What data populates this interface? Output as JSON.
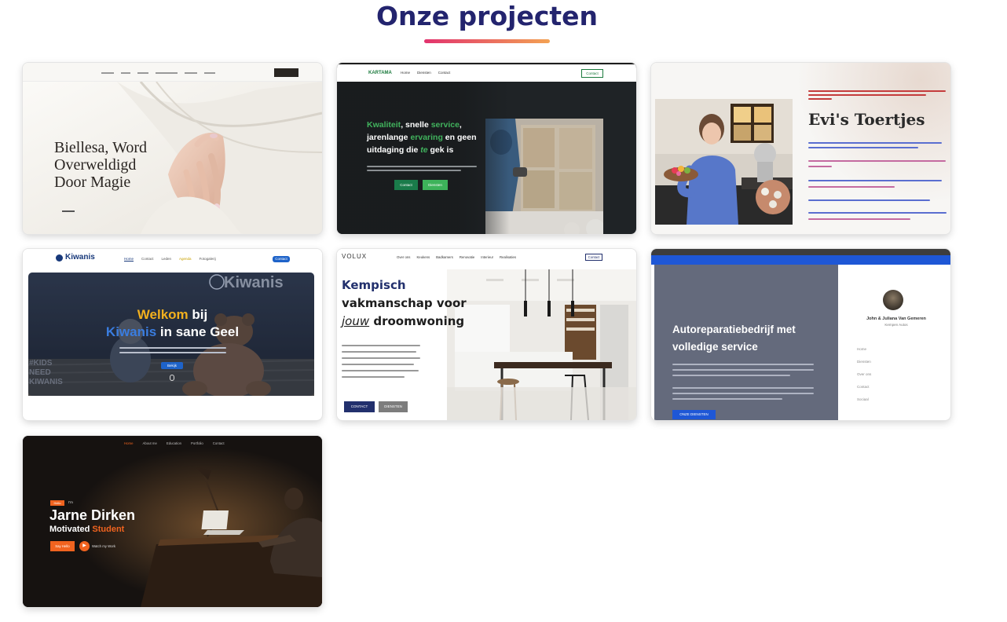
{
  "section": {
    "title": "Onze projecten"
  },
  "colors": {
    "title": "#23246e",
    "accent_start": "#e2336e",
    "accent_end": "#f3a253"
  },
  "projects": [
    {
      "headline": [
        "Biellesa, Word",
        "Overweldigd",
        "Door Magie"
      ],
      "image_subject": "hand with manicured nails in white fabric"
    },
    {
      "logo": "KARTAMA",
      "nav": [
        "Home",
        "Diensten",
        "Contact"
      ],
      "cta": "Contact",
      "headline_parts": {
        "green1": "Kwaliteit",
        "white1": ", snelle ",
        "green2": "service",
        "white2": ",",
        "line2a": "jarenlange ",
        "green3": "ervaring",
        "line2b": " en geen",
        "line3a": "uitdaging die ",
        "green4": "te",
        "line3b": " gek is"
      },
      "buttons": [
        "Contact",
        "Diensten"
      ],
      "image_subject": "worker installing insulation panels"
    },
    {
      "heading": "Evi's Toertjes",
      "image_subject": "woman in blue sweater holding a cake in a kitchen"
    },
    {
      "logo": "Kiwanis",
      "nav": [
        "Home",
        "Contact",
        "Leden",
        "Agenda",
        "Fotogalerij"
      ],
      "cta": "Contact",
      "hero_watermark": "Kiwanis",
      "headline_line1_yellow": "Welkom",
      "headline_line1_white": " bij",
      "headline_line2_blue": "Kiwanis",
      "headline_line2_white": " in sane Geel",
      "side_text": [
        "#KIDS",
        "NEED",
        "KIWANIS"
      ],
      "button": "Bekijk"
    },
    {
      "logo": "VOLUX",
      "nav": [
        "Over ons",
        "Keukens",
        "Badkamers",
        "Renovatie",
        "Interieur",
        "Realisaties"
      ],
      "cta": "Contact",
      "headline_blue": "Kempisch",
      "headline_line2": "vakmanschap voor",
      "headline_line3a": "jouw",
      "headline_line3b": " droomwoning",
      "buttons": [
        "CONTACT",
        "DIENSTEN"
      ],
      "image_subject": "modern white kitchen with dark dining table"
    },
    {
      "headline": "Autoreparatiebedrijf met volledige service",
      "button": "ONZE DIENSTEN",
      "sidebar_name": "John & Juliana Van Gemeren",
      "sidebar_sub": "Kempen Autos",
      "sidebar_menu": [
        "Home",
        "Diensten",
        "Over ons",
        "Contact",
        "Sociaal"
      ]
    },
    {
      "nav": [
        "Home",
        "About me",
        "Education",
        "Portfolio",
        "Contact"
      ],
      "tags": [
        "Hello",
        "I'm"
      ],
      "name": "Jarne Dirken",
      "subtitle_white": "Motivated ",
      "subtitle_orange": "Student",
      "button": "Say Hello",
      "watch": "Watch my Work",
      "image_subject": "person working at laptop in dark room under lamp"
    }
  ]
}
